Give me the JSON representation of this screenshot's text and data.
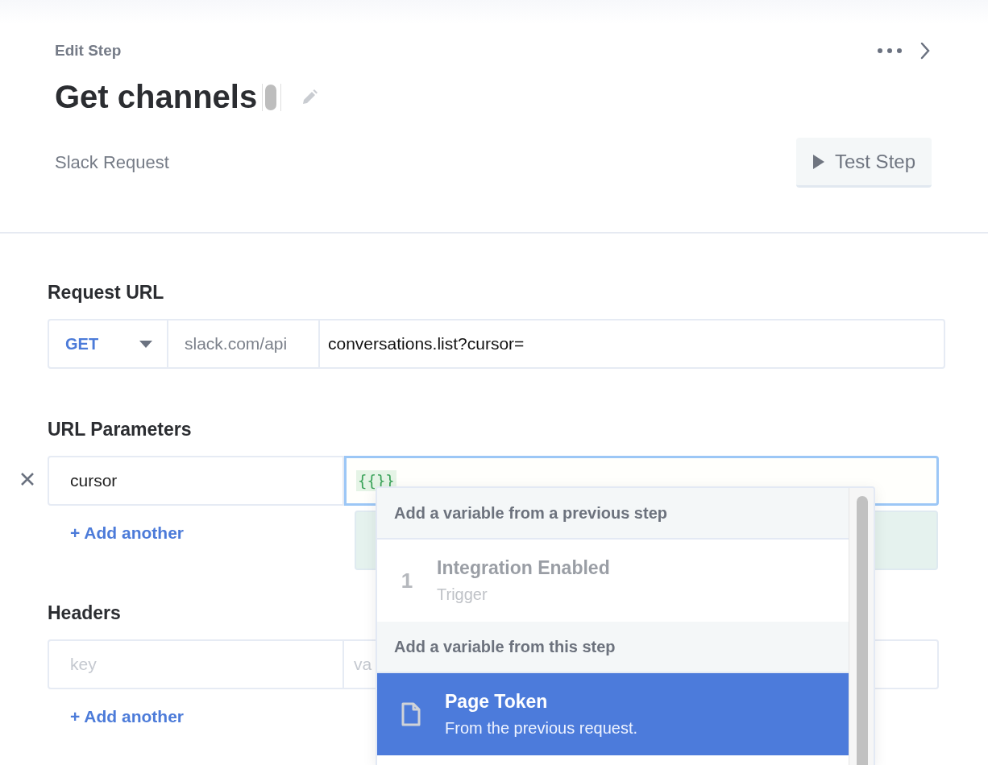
{
  "panel": {
    "label": "Edit Step",
    "title": "Get channels",
    "subtitle": "Slack Request",
    "test_button": "Test Step"
  },
  "request_url": {
    "heading": "Request URL",
    "method": "GET",
    "base": "slack.com/api",
    "path": "conversations.list?cursor="
  },
  "url_parameters": {
    "heading": "URL Parameters",
    "rows": [
      {
        "key": "cursor",
        "value": "{{}}",
        "focused": true
      }
    ],
    "add_link": "+ Add another"
  },
  "headers": {
    "heading": "Headers",
    "rows": [
      {
        "key_placeholder": "key",
        "value_placeholder": "va"
      }
    ],
    "add_link": "+ Add another"
  },
  "dropdown": {
    "sections": [
      {
        "heading": "Add a variable from a previous step",
        "items": [
          {
            "kind": "step",
            "number": "1",
            "title": "Integration Enabled",
            "subtitle": "Trigger",
            "selected": false
          }
        ]
      },
      {
        "heading": "Add a variable from this step",
        "items": [
          {
            "kind": "variable",
            "title": "Page Token",
            "subtitle": "From the previous request.",
            "selected": true
          }
        ]
      }
    ]
  }
}
